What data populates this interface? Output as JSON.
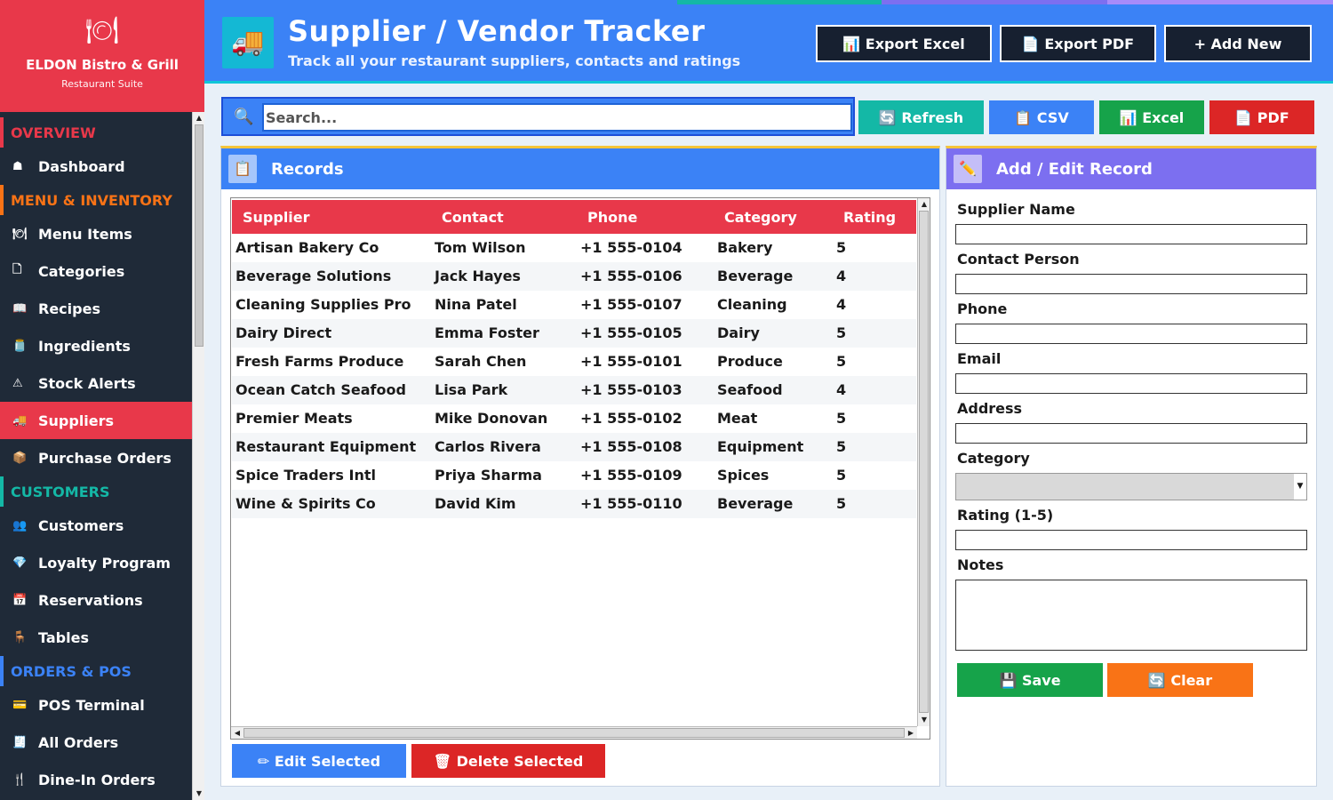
{
  "colors": {
    "brand": "#e8384a",
    "sidebar": "#1f2a38",
    "header": "#3b82f6",
    "teal": "#14b8a6",
    "green": "#16a34a",
    "orange": "#f97316",
    "red": "#dc2626",
    "purple": "#7c6ff0",
    "dark": "#172030"
  },
  "brand": {
    "name": "ELDON Bistro & Grill",
    "sub": "Restaurant Suite",
    "icon": "plate-cutlery-icon"
  },
  "sidebar": {
    "sections": [
      {
        "title": "OVERVIEW",
        "color": "#e8384a",
        "items": [
          {
            "label": "Dashboard",
            "icon": "☗"
          }
        ]
      },
      {
        "title": "MENU & INVENTORY",
        "color": "#f97316",
        "items": [
          {
            "label": "Menu Items",
            "icon": "🍽"
          },
          {
            "label": "Categories",
            "icon": "🗋"
          },
          {
            "label": "Recipes",
            "icon": "📖"
          },
          {
            "label": "Ingredients",
            "icon": "🫙"
          },
          {
            "label": "Stock Alerts",
            "icon": "⚠"
          },
          {
            "label": "Suppliers",
            "icon": "🚚"
          },
          {
            "label": "Purchase Orders",
            "icon": "📦"
          }
        ]
      },
      {
        "title": "CUSTOMERS",
        "color": "#14b8a6",
        "items": [
          {
            "label": "Customers",
            "icon": "👥"
          },
          {
            "label": "Loyalty Program",
            "icon": "💎"
          },
          {
            "label": "Reservations",
            "icon": "📅"
          },
          {
            "label": "Tables",
            "icon": "🪑"
          }
        ]
      },
      {
        "title": "ORDERS & POS",
        "color": "#3b82f6",
        "items": [
          {
            "label": "POS Terminal",
            "icon": "💳"
          },
          {
            "label": "All Orders",
            "icon": "🧾"
          },
          {
            "label": "Dine-In Orders",
            "icon": "🍴"
          }
        ]
      }
    ],
    "active": "Suppliers"
  },
  "header": {
    "title": "Supplier / Vendor Tracker",
    "subtitle": "Track all your restaurant suppliers, contacts and ratings",
    "icon": "truck-icon",
    "export_excel": "📊 Export Excel",
    "export_pdf": "📄 Export PDF",
    "add_new": "+ Add New"
  },
  "toolbar": {
    "search_placeholder": "Search...",
    "refresh": "🔄 Refresh",
    "csv": "📋 CSV",
    "excel": "📊 Excel",
    "pdf": "📄 PDF"
  },
  "records": {
    "title": "Records",
    "columns": [
      "Supplier",
      "Contact",
      "Phone",
      "Category",
      "Rating"
    ],
    "rows": [
      [
        "Artisan Bakery Co",
        "Tom Wilson",
        "+1 555-0104",
        "Bakery",
        "5"
      ],
      [
        "Beverage Solutions",
        "Jack Hayes",
        "+1 555-0106",
        "Beverage",
        "4"
      ],
      [
        "Cleaning Supplies Pro",
        "Nina Patel",
        "+1 555-0107",
        "Cleaning",
        "4"
      ],
      [
        "Dairy Direct",
        "Emma Foster",
        "+1 555-0105",
        "Dairy",
        "5"
      ],
      [
        "Fresh Farms Produce",
        "Sarah Chen",
        "+1 555-0101",
        "Produce",
        "5"
      ],
      [
        "Ocean Catch Seafood",
        "Lisa Park",
        "+1 555-0103",
        "Seafood",
        "4"
      ],
      [
        "Premier Meats",
        "Mike Donovan",
        "+1 555-0102",
        "Meat",
        "5"
      ],
      [
        "Restaurant Equipment",
        "Carlos Rivera",
        "+1 555-0108",
        "Equipment",
        "5"
      ],
      [
        "Spice Traders Intl",
        "Priya Sharma",
        "+1 555-0109",
        "Spices",
        "5"
      ],
      [
        "Wine & Spirits Co",
        "David Kim",
        "+1 555-0110",
        "Beverage",
        "5"
      ]
    ],
    "edit_selected": "✏ Edit Selected",
    "delete_selected": "🗑 Delete Selected"
  },
  "form": {
    "title": "Add / Edit Record",
    "fields": {
      "supplier_name": "Supplier Name",
      "contact_person": "Contact Person",
      "phone": "Phone",
      "email": "Email",
      "address": "Address",
      "category": "Category",
      "rating": "Rating (1-5)",
      "notes": "Notes"
    },
    "save": "💾 Save",
    "clear": "🔄 Clear"
  }
}
